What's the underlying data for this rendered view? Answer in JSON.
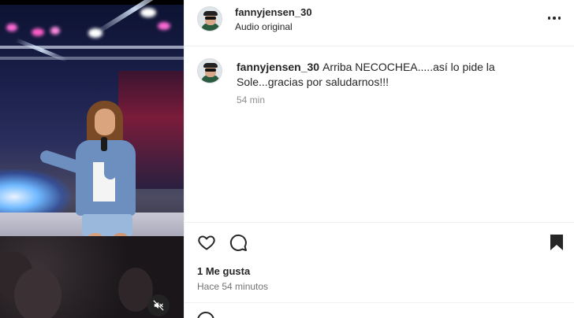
{
  "post": {
    "username": "fannyjensen_30",
    "audio": "Audio original",
    "more_icon": "more-horizontal-icon"
  },
  "comments": [
    {
      "username": "fannyjensen_30",
      "text": "Arriba NECOCHEA.....así lo pide la Sole...gracias por saludarnos!!!",
      "time": "54 min"
    }
  ],
  "actions": {
    "like_icon": "heart-icon",
    "comment_icon": "comment-icon",
    "save_icon": "bookmark-icon"
  },
  "stats": {
    "likes": "1 Me gusta",
    "timestamp": "Hace 54 minutos"
  },
  "media": {
    "mute_icon": "speaker-muted-icon"
  },
  "colors": {
    "text": "#262626",
    "secondary_text": "#8e8e8e",
    "divider": "#efefef"
  }
}
